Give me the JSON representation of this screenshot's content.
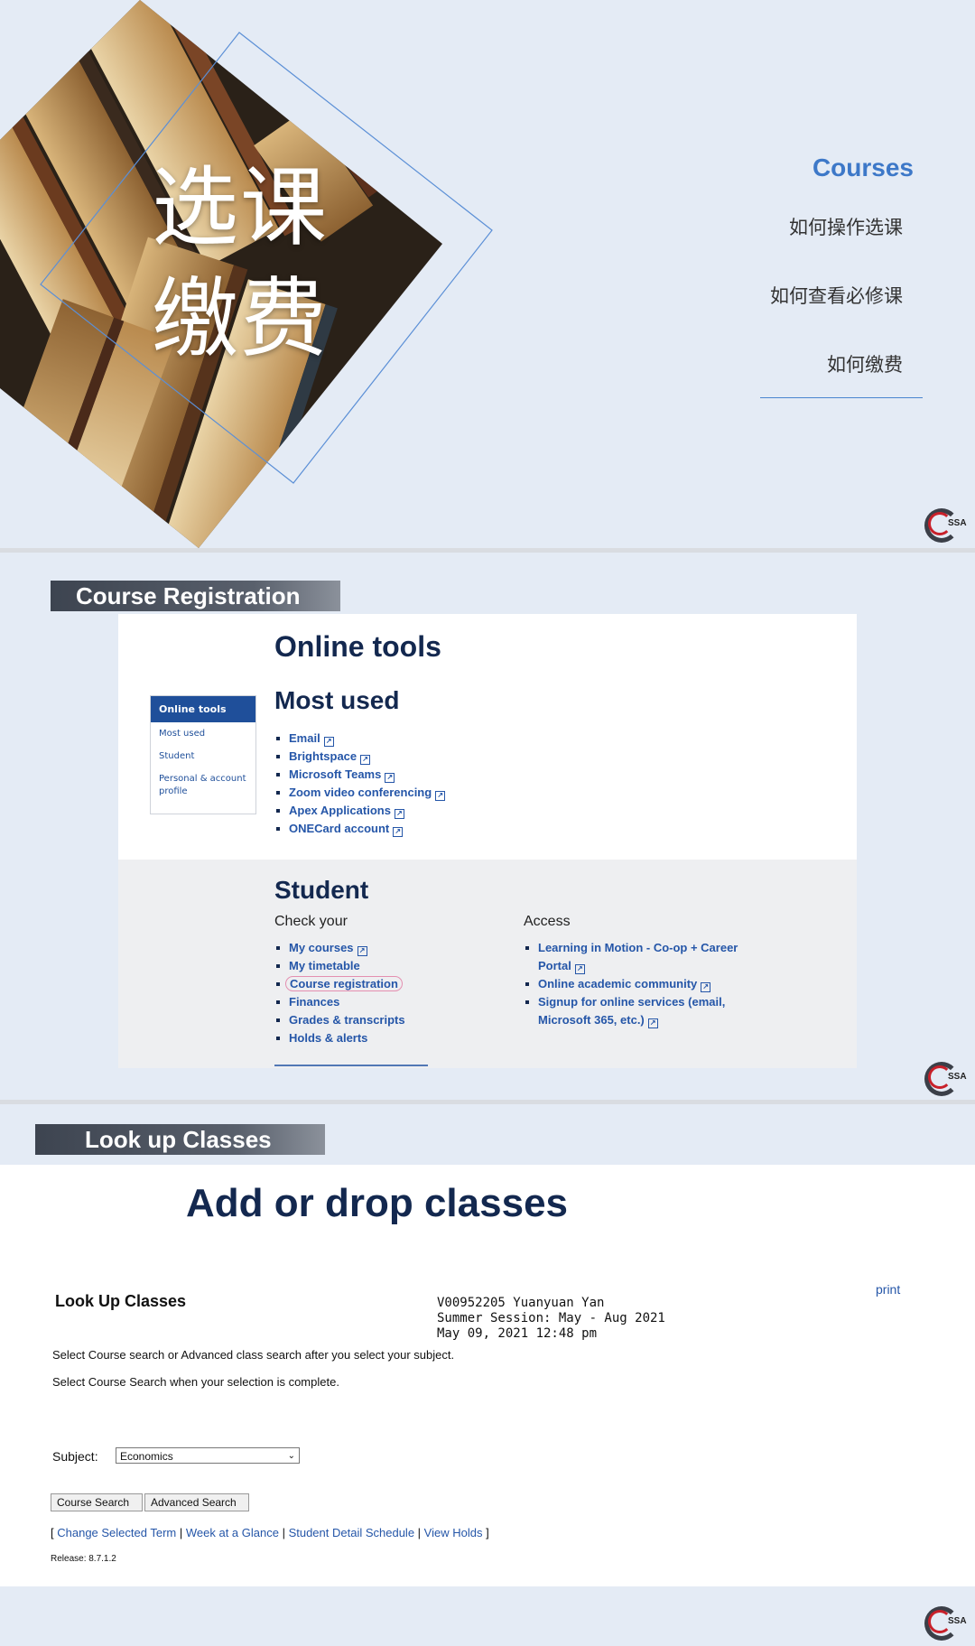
{
  "slide1": {
    "title_line1": "选课",
    "title_line2": "缴费",
    "menu_heading": "Courses",
    "menu_items": [
      "如何操作选课",
      "如何查看必修课",
      "如何缴费"
    ],
    "logo_text": "SSA"
  },
  "slide2": {
    "banner": "Course Registration",
    "heading": "Online tools",
    "sidebar": {
      "active": "Online tools",
      "items": [
        "Most used",
        "Student",
        "Personal & account profile"
      ]
    },
    "most_used": {
      "heading": "Most used",
      "links": [
        "Email",
        "Brightspace",
        "Microsoft Teams",
        "Zoom video conferencing",
        "Apex Applications",
        "ONECard account"
      ]
    },
    "student": {
      "heading": "Student",
      "check_heading": "Check your",
      "check_links": [
        "My courses",
        "My timetable",
        "Course registration",
        "Finances",
        "Grades & transcripts",
        "Holds & alerts"
      ],
      "access_heading": "Access",
      "access_links": [
        "Learning in Motion - Co-op + Career Portal",
        "Online academic community",
        "Signup for online services (email, Microsoft 365, etc.)"
      ]
    },
    "logo_text": "SSA"
  },
  "slide3": {
    "banner": "Look up Classes",
    "heading": "Add or drop classes",
    "lookup_title": "Look Up Classes",
    "print_label": "print",
    "student_line": "V00952205 Yuanyuan Yan",
    "term_line": "Summer Session: May - Aug 2021",
    "date_line": "May 09, 2021 12:48 pm",
    "instruction1": "Select Course search or Advanced class search after you select your subject.",
    "instruction2": "Select Course Search when your selection is complete.",
    "subject_label": "Subject:",
    "subject_value": "Economics",
    "course_search_label": "Course Search",
    "advanced_search_label": "Advanced Search",
    "footer_links": [
      "Change Selected Term",
      "Week at a Glance",
      "Student Detail Schedule",
      "View Holds"
    ],
    "release": "Release: 8.7.1.2",
    "logo_text": "SSA"
  }
}
